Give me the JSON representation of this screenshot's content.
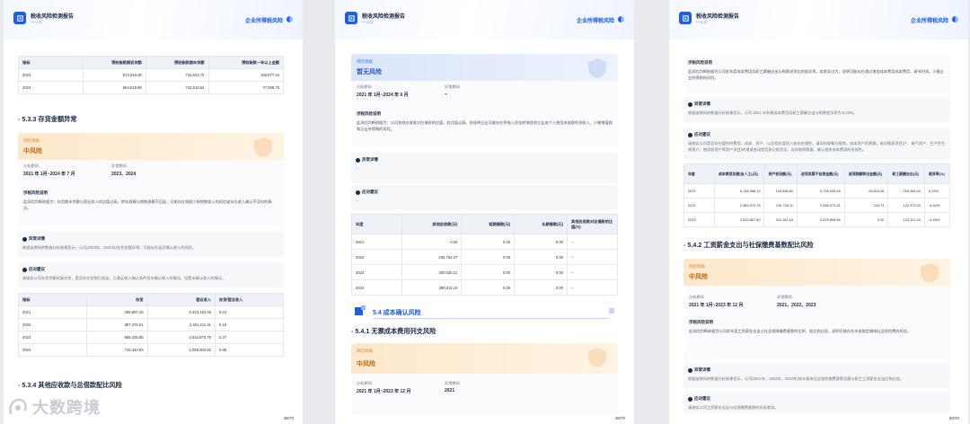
{
  "header": {
    "title": "税收风险检测报告",
    "subtitle": "***公司",
    "tag": "企业所得税风险"
  },
  "watermark": "大数跨境",
  "page1": {
    "page_number": "48/70",
    "top_table": {
      "columns": [
        "指标",
        "预收账款期初余额",
        "预收账款期末余额",
        "预收账款一年以上金额"
      ],
      "rows": [
        [
          "2023",
          "573,046.28",
          "734,523.72",
          "160,577.44"
        ],
        [
          "2024",
          "664,518.89",
          "742,518.64",
          "77,599.75"
        ]
      ]
    },
    "section_533": {
      "num": "5.3.3",
      "title": "存货金额异常"
    },
    "risk": {
      "label": "风险等级",
      "level": "中风险",
      "period_key": "分析期间",
      "period_val": "2021 年 1月~2024 年 7 月",
      "abn_key": "异常期间",
      "abn_val": "2023、2024",
      "desc_title": "涉税风险说明",
      "desc": "此风险判断依据为：存货期末余额与营业收入的比值过高，库存规模与销售规模不匹配，可能存在隐匿少报销售收入的风险或存在收入确认不及时的情况。"
    },
    "abnormal": {
      "title": "异常详情",
      "body": "根据该期间的数据分析结果显示，公司(2023年、2024年)存货金额异常，可能存在延迟确认收入的风险。"
    },
    "advice": {
      "title": "应对建议",
      "body": "请核实公司存货余额的真实性，是否存在货物已发出，已满足收入确认条件但未确认收入的情况，但是未确认收入的情况。"
    },
    "stock_table": {
      "columns": [
        "指标",
        "存货",
        "营业收入",
        "存货/营业收入"
      ],
      "rows": [
        [
          "2021",
          "259,867.16",
          "6,323,193.03",
          "0.04"
        ],
        [
          "2022",
          "387,376.51",
          "2,491,211.41",
          "0.16"
        ],
        [
          "2023",
          "685,335.85",
          "2,542,873.79",
          "0.27"
        ],
        [
          "2024",
          "715,440.93",
          "1,058,804.82",
          "0.68"
        ]
      ]
    },
    "section_534": {
      "num": "5.3.4",
      "title": "其他应收款与总借款配比风险"
    }
  },
  "page2": {
    "page_number": "49/70",
    "risk": {
      "label": "风险等级",
      "level": "暂无风险",
      "period_key": "分析期间",
      "period_val": "2021 年 1月~2024 年 6 月",
      "abn_key": "异常期间",
      "abn_val": "--",
      "desc_title": "涉税风险说明",
      "desc": "此风险判断依据为：公司其他应收款对应借款的比值，若比值过高，则说明企业可能存在将借入资金转借其他企业或个人使用未收取利息收入，少缴增值税和企业所得税的风险。"
    },
    "abnormal": {
      "title": "异常详情",
      "body": "--"
    },
    "advice": {
      "title": "应对建议",
      "body": "--"
    },
    "table": {
      "columns": [
        "年度",
        "其他应收款(元)",
        "短期借款(元)",
        "长期借款(元)",
        "其他应收款对总借款的比值(%)"
      ],
      "rows": [
        [
          "2021",
          "0.00",
          "0.00",
          "0.00",
          "--"
        ],
        [
          "2022",
          "205,754.37",
          "0.00",
          "0.00",
          "--"
        ],
        [
          "2023",
          "300,530.21",
          "0.00",
          "0.00",
          "--"
        ],
        [
          "2024",
          "280,911.10",
          "0.00",
          "0.00",
          "--"
        ]
      ]
    },
    "chapter": "5.4  成本确认风险",
    "section_541": {
      "num": "5.4.1",
      "title": "无票成本费用列支风险"
    },
    "risk2": {
      "label": "风险等级",
      "level": "中风险",
      "period_key": "分析期间",
      "period_val": "2021 年 1月~2023 年 12 月",
      "abn_key": "异常期间",
      "abn_val": "2021"
    }
  },
  "page3": {
    "page_number": "50/70",
    "desc": {
      "title": "涉税风险说明",
      "body": "此风险判断依据为公司各年度成本费用及职工薪酬支出与购票进项比的差异率。若差异过大，说明可能存在通过增加成本费用成本费用，调节利润，少缴企业所得税的风险。"
    },
    "abnormal": {
      "title": "异常详情",
      "body": "根据该期间的数据分析结果显示，公司 2021 年有票成本费用及职工薪酬支出与购票差异率为 6.23%。"
    },
    "advice": {
      "title": "应对建议",
      "body": "请核实公司是否存在管控的费用、成本、资产，以及相应暂估入账的合理性。请及时收集与报销，成本资产的票据，核对报表项目(产、废气资产、生产性生物资产、使用权资产等资产项目)的增减变动是否和记账凭证，及时取得票据，确认相关成本费用的合理性。"
    },
    "table": {
      "columns": [
        "年度",
        "成本费用总额(含人工)(元)",
        "资产变动额(元)",
        "进项发票不含税金额(元)",
        "进项税额转出金额(元)",
        "职工薪酬支出(元)",
        "差异率(%)"
      ],
      "rows": [
        [
          "2021",
          "6,138,388.13",
          "134,536.80",
          "5,750,035.45",
          "25,813.28",
          "200,484.00",
          "6.23%"
        ],
        [
          "2022",
          "2,465,579.78",
          "106,728.11",
          "2,566,973.31",
          "224.73",
          "122,373.00",
          "-4.64%"
        ],
        [
          "2023",
          "2,515,687.60",
          "311,161.18",
          "2,829,808.86",
          "0.00",
          "123,121.00",
          "-4.46%"
        ]
      ]
    },
    "section_542": {
      "num": "5.4.2",
      "title": "工资薪金支出与社保缴费基数配比风险"
    },
    "risk": {
      "label": "风险等级",
      "level": "中风险",
      "period_key": "分析期间",
      "period_val": "2021 年 1月~2023 年 12 月",
      "abn_key": "异常期间",
      "abn_val": "2021、2022、2023",
      "desc_title": "涉税风险说明",
      "desc": "此风险判断依据为公司各年度工资薪金支出占社会保障缴费基数的比例，若比例过低，说明可能存在未按规定缴纳社会保险费的风险。"
    },
    "abnormal2": {
      "title": "异常详情",
      "body": "根据该期间的数据分析结果显示，公司(2021年、2022年、2023年)各年基本社会保险缴费基数总额与职工工资薪金支出比例过低。"
    },
    "advice2": {
      "title": "应对建议",
      "body": "请核实公司工资薪金支出与社保缴费基数的实际差异。"
    }
  }
}
